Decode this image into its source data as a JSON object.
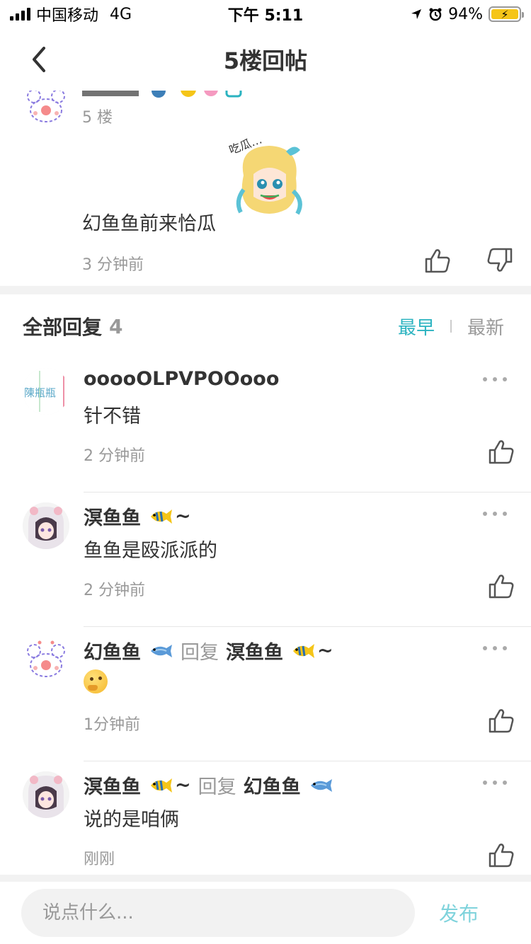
{
  "status_bar": {
    "carrier": "中国移动",
    "network": "4G",
    "time": "下午 5:11",
    "battery": "94%"
  },
  "nav": {
    "title": "5楼回帖"
  },
  "floor_post": {
    "floor_label": "5 楼",
    "content": "幻鱼鱼前来恰瓜",
    "sticker_text": "吃瓜…",
    "time": "3 分钟前"
  },
  "replies_header": {
    "label": "全部回复",
    "count": "4",
    "sort_earliest": "最早",
    "sort_latest": "最新"
  },
  "replies": [
    {
      "user": "ooooOLPVPOOooo",
      "avatar_text": "陳瓶瓶",
      "text": "针不错",
      "time": "2 分钟前"
    },
    {
      "user": "溟鱼鱼",
      "user_suffix": "~",
      "text": "鱼鱼是殴派派的",
      "time": "2 分钟前"
    },
    {
      "user": "幻鱼鱼",
      "reply_word": "回复",
      "target": "溟鱼鱼",
      "target_suffix": "~",
      "time": "1分钟前"
    },
    {
      "user": "溟鱼鱼",
      "user_suffix": "~",
      "reply_word": "回复",
      "target": "幻鱼鱼",
      "text": "说的是咱俩",
      "time": "刚刚"
    }
  ],
  "composer": {
    "placeholder": "说点什么...",
    "publish_label": "发布"
  },
  "colors": {
    "accent": "#2bb3c0",
    "publish": "#7fd3dc",
    "muted": "#999999",
    "divider": "#f2f2f2"
  }
}
